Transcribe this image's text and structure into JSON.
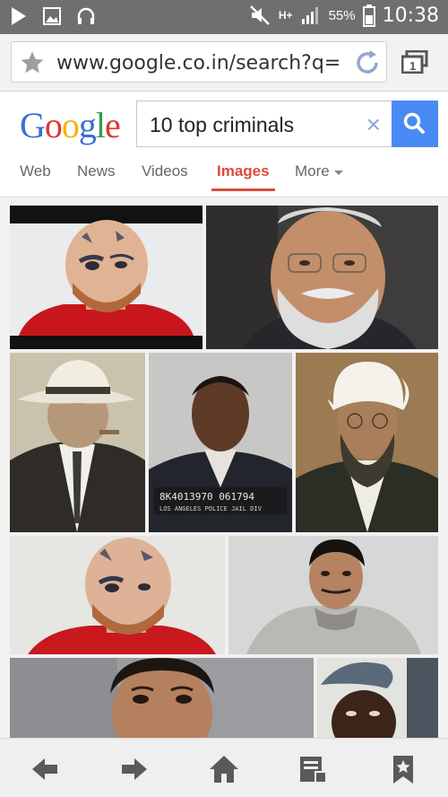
{
  "status": {
    "battery": "55%",
    "time": "10:38",
    "network": "H+"
  },
  "browser": {
    "url": "www.google.co.in/search?q=",
    "icons": [
      "play-icon",
      "image-icon",
      "headphones-icon",
      "mute-icon",
      "signal-icon",
      "star-icon",
      "reload-icon",
      "tabs-icon"
    ]
  },
  "google": {
    "logo": "Google",
    "query": "10 top criminals",
    "clear": "×",
    "tabs": [
      {
        "label": "Web"
      },
      {
        "label": "News"
      },
      {
        "label": "Videos"
      },
      {
        "label": "Images"
      },
      {
        "label": "More"
      }
    ],
    "active_tab": "Images",
    "accent": "#dd4b39",
    "button_color": "#4a8af4"
  },
  "results": {
    "tiles": [
      {
        "name": "tattooed-man-photo",
        "caption_strip": ""
      },
      {
        "name": "white-bearded-man-photo",
        "caption_strip": ""
      },
      {
        "name": "man-in-fedora-photo",
        "caption_strip": ""
      },
      {
        "name": "mugshot-photo",
        "caption_strip": "8K4013970 061794"
      },
      {
        "name": "man-in-turban-photo",
        "caption_strip": ""
      },
      {
        "name": "tattooed-man-photo-2",
        "caption_strip": ""
      },
      {
        "name": "man-in-jacket-photo",
        "caption_strip": ""
      },
      {
        "name": "young-man-photo",
        "caption_strip": ""
      },
      {
        "name": "man-in-beret-photo",
        "caption_strip": ""
      }
    ],
    "mugshot_sign_line2": "LOS ANGELES POLICE   JAIL DIV"
  },
  "bottom": {
    "icons": [
      "back-icon",
      "forward-icon",
      "home-icon",
      "reader-icon",
      "bookmark-icon"
    ]
  }
}
